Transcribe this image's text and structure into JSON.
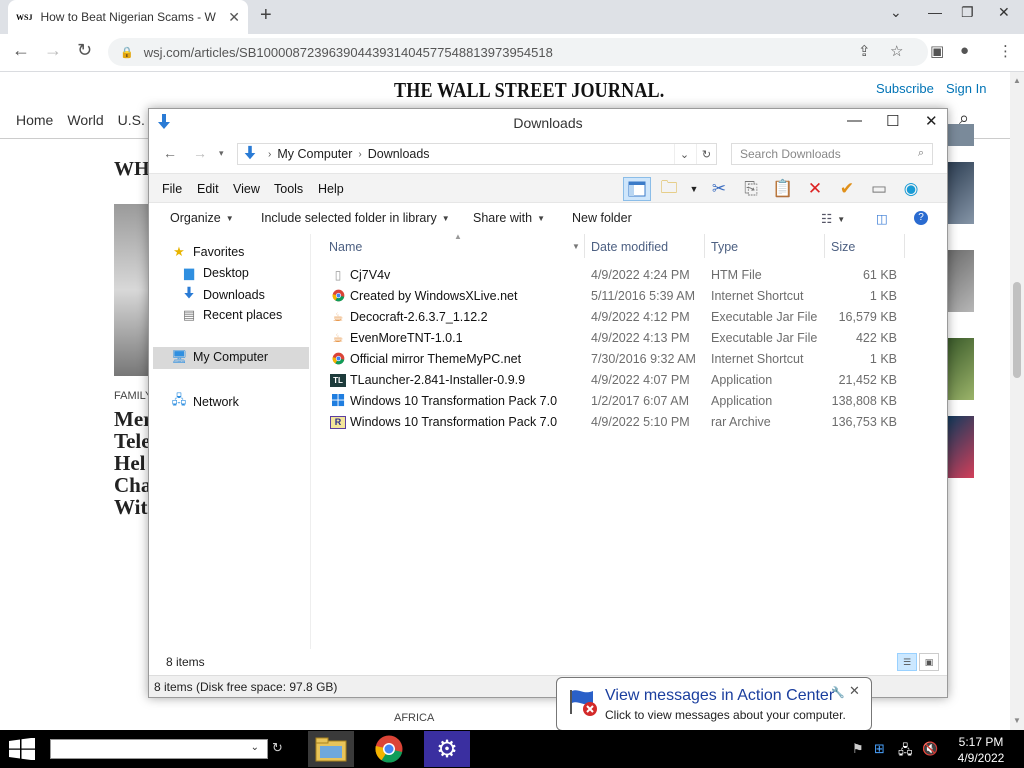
{
  "browser": {
    "tab_title": "How to Beat Nigerian Scams - W",
    "tab_favicon": "WSJ",
    "url": "wsj.com/articles/SB10000872396390443931404577548813973954518"
  },
  "website": {
    "logo": "THE WALL STREET JOURNAL.",
    "subscribe": "Subscribe",
    "sign_in": "Sign In",
    "nav": [
      "Home",
      "World",
      "U.S."
    ],
    "headline_fragment": "WHA",
    "section_label": "FAMILY",
    "headline_lines": [
      "Mer",
      "Tele",
      "Hel",
      "Cha",
      "Wit"
    ],
    "bottom_label": "AFRICA"
  },
  "explorer": {
    "title": "Downloads",
    "breadcrumb": [
      "My Computer",
      "Downloads"
    ],
    "search_placeholder": "Search Downloads",
    "menu": [
      "File",
      "Edit",
      "View",
      "Tools",
      "Help"
    ],
    "commands": {
      "organize": "Organize",
      "include": "Include selected folder in library",
      "share": "Share with",
      "new_folder": "New folder"
    },
    "nav_pane": {
      "favorites": "Favorites",
      "desktop": "Desktop",
      "downloads": "Downloads",
      "recent": "Recent places",
      "computer": "My Computer",
      "network": "Network"
    },
    "columns": {
      "name": "Name",
      "date": "Date modified",
      "type": "Type",
      "size": "Size"
    },
    "files": [
      {
        "name": "Cj7V4v",
        "date": "4/9/2022 4:24 PM",
        "type": "HTM File",
        "size": "61 KB",
        "icon": "file-icon"
      },
      {
        "name": "Created by WindowsXLive.net",
        "date": "5/11/2016 5:39 AM",
        "type": "Internet Shortcut",
        "size": "1 KB",
        "icon": "chrome-icon"
      },
      {
        "name": "Decocraft-2.6.3.7_1.12.2",
        "date": "4/9/2022 4:12 PM",
        "type": "Executable Jar File",
        "size": "16,579 KB",
        "icon": "java-icon"
      },
      {
        "name": "EvenMoreTNT-1.0.1",
        "date": "4/9/2022 4:13 PM",
        "type": "Executable Jar File",
        "size": "422 KB",
        "icon": "java-icon"
      },
      {
        "name": "Official mirror ThemeMyPC.net",
        "date": "7/30/2016 9:32 AM",
        "type": "Internet Shortcut",
        "size": "1 KB",
        "icon": "chrome-icon"
      },
      {
        "name": "TLauncher-2.841-Installer-0.9.9",
        "date": "4/9/2022 4:07 PM",
        "type": "Application",
        "size": "21,452 KB",
        "icon": "tlauncher-icon"
      },
      {
        "name": "Windows 10 Transformation Pack 7.0",
        "date": "1/2/2017 6:07 AM",
        "type": "Application",
        "size": "138,808 KB",
        "icon": "windows-icon"
      },
      {
        "name": "Windows 10 Transformation Pack 7.0",
        "date": "4/9/2022 5:10 PM",
        "type": "rar Archive",
        "size": "136,753 KB",
        "icon": "rar-icon"
      }
    ],
    "item_count": "8 items",
    "status_bar": "8 items (Disk free space: 97.8 GB)"
  },
  "notification": {
    "title": "View messages in Action Center",
    "text": "Click to view messages about your computer."
  },
  "taskbar": {
    "time": "5:17 PM",
    "date": "4/9/2022"
  }
}
